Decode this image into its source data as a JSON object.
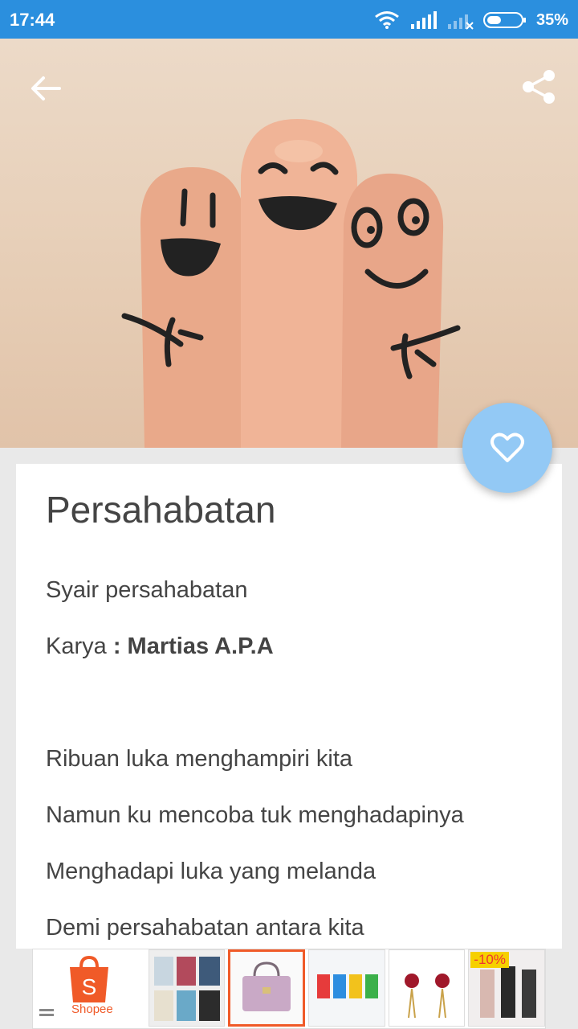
{
  "status_bar": {
    "time": "17:44",
    "battery_percent": "35%"
  },
  "hero": {
    "image_icon": "finger-faces-image",
    "back_icon": "arrow-left-icon",
    "share_icon": "share-icon",
    "favorite_icon": "heart-icon",
    "favorite_color": "#93c9f5"
  },
  "article": {
    "title": "Persahabatan",
    "subtitle": "Syair  persahabatan",
    "author_prefix": "Karya ",
    "author_name": ": Martias A.P.A",
    "verses": [
      "Ribuan luka menghampiri kita",
      "Namun ku mencoba tuk menghadapinya",
      "Menghadapi luka yang melanda",
      "Demi persahabatan antara kita"
    ]
  },
  "ad_bar": {
    "shopee_label": "Shopee",
    "discount_badge": "-10%",
    "accent": "#f05a28"
  }
}
